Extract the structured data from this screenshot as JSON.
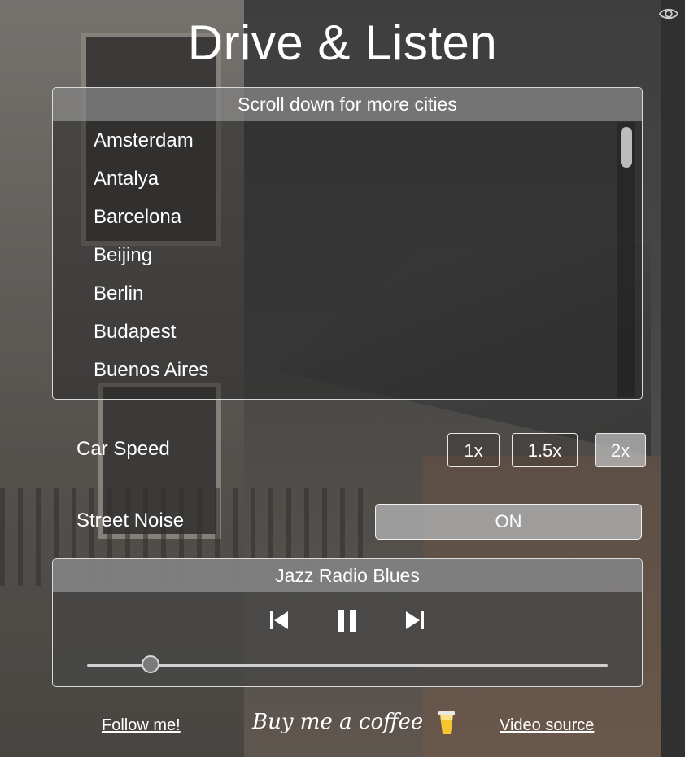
{
  "app": {
    "title": "Drive & Listen"
  },
  "cities": {
    "header": "Scroll down for more cities",
    "items": [
      "Amsterdam",
      "Antalya",
      "Barcelona",
      "Beijing",
      "Berlin",
      "Budapest",
      "Buenos Aires"
    ]
  },
  "controls": {
    "car_speed": {
      "label": "Car Speed",
      "options": [
        "1x",
        "1.5x",
        "2x"
      ],
      "selected": "2x"
    },
    "street_noise": {
      "label": "Street Noise",
      "value": "ON"
    }
  },
  "radio": {
    "station": "Jazz Radio Blues",
    "volume": 0.12
  },
  "footer": {
    "follow": "Follow me!",
    "coffee": "Buy me a coffee",
    "source": "Video source"
  },
  "icons": {
    "visibility": "eye-icon",
    "previous": "skip-previous-icon",
    "pause": "pause-icon",
    "next": "skip-next-icon",
    "coffee": "coffee-cup-icon"
  }
}
